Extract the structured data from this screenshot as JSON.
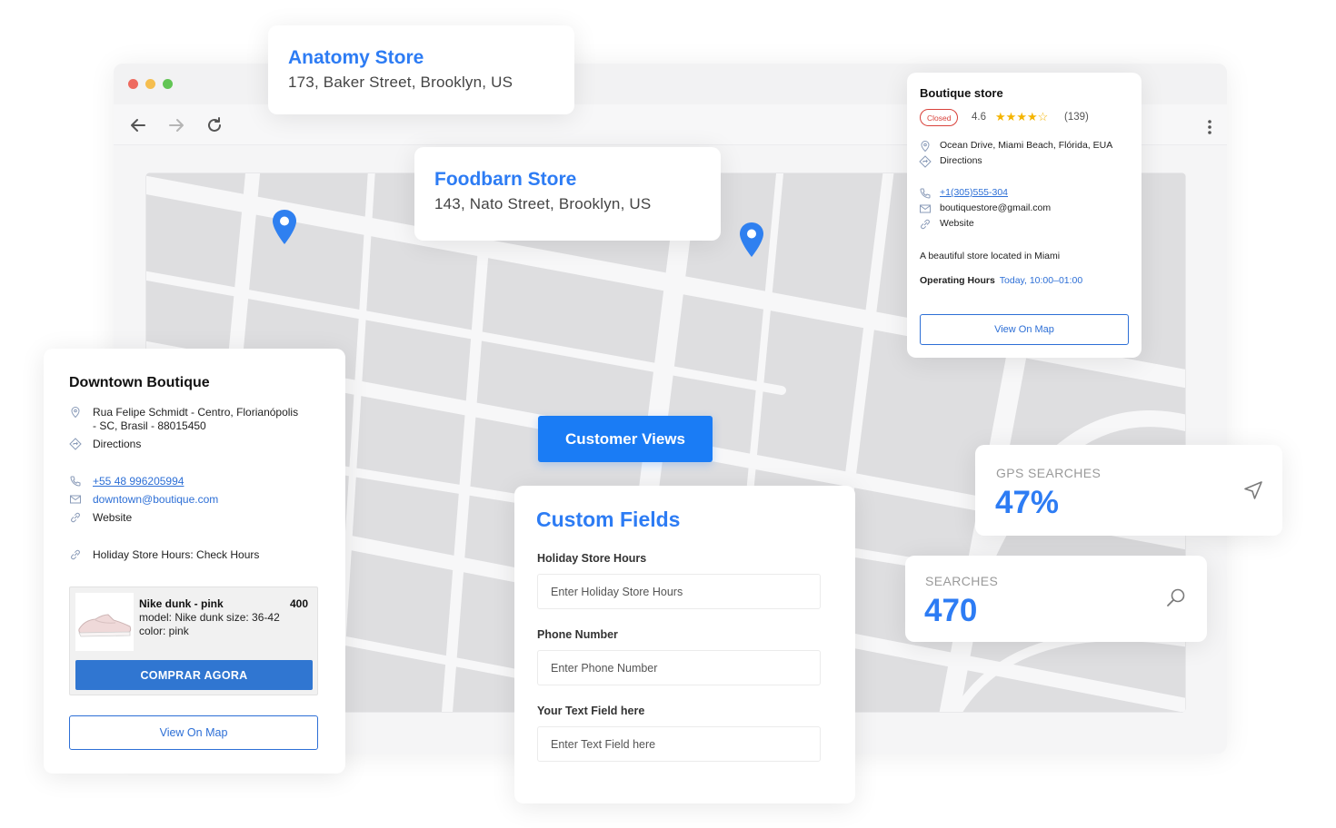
{
  "browser": {
    "nav": {
      "back": "arrow-left-icon",
      "forward": "arrow-right-icon",
      "reload": "reload-icon",
      "menu": "kebab-menu-icon"
    }
  },
  "anatomy_store": {
    "name": "Anatomy Store",
    "address": "173, Baker Street, Brooklyn, US"
  },
  "foodbarn_store": {
    "name": "Foodbarn Store",
    "address": "143, Nato Street, Brooklyn, US"
  },
  "boutique_store": {
    "name": "Boutique store",
    "status": "Closed",
    "rating": "4.6",
    "stars": 4,
    "reviews": "(139)",
    "address": "Ocean Drive, Miami Beach, Flórida, EUA",
    "directions": "Directions",
    "phone": "+1(305)555-304",
    "email": "boutiquestore@gmail.com",
    "website": "Website",
    "description": "A beautiful store located in Miami",
    "hours_label": "Operating Hours",
    "hours_value": "Today, 10:00–01:00",
    "view_on_map": "View On Map"
  },
  "downtown_boutique": {
    "name": "Downtown Boutique",
    "address_line1": "Rua Felipe Schmidt - Centro, Florianópolis",
    "address_line2": "- SC, Brasil - 88015450",
    "directions": "Directions",
    "phone": "+55 48 996205994",
    "email": "downtown@boutique.com",
    "website": "Website",
    "holiday_hours": "Holiday Store Hours: Check Hours",
    "product": {
      "name": "Nike dunk - pink",
      "price": "400",
      "model": "model: Nike dunk size: 36-42",
      "color": "color: pink",
      "buy_button": "COMPRAR AGORA"
    },
    "view_on_map": "View On Map"
  },
  "customer_views_button": "Customer Views",
  "custom_fields": {
    "title": "Custom Fields",
    "fields": [
      {
        "label": "Holiday Store Hours",
        "placeholder": "Enter Holiday Store Hours"
      },
      {
        "label": "Phone Number",
        "placeholder": "Enter Phone Number"
      },
      {
        "label": "Your Text Field here",
        "placeholder": "Enter Text Field here"
      }
    ]
  },
  "gps_searches": {
    "label": "GPS SEARCHES",
    "value": "47%",
    "icon": "navigation-arrow-icon"
  },
  "searches": {
    "label": "SEARCHES",
    "value": "470",
    "icon": "search-icon"
  },
  "colors": {
    "accent": "#2d7cf4",
    "button_blue": "#1a7cf5",
    "buy_button": "#3076d1",
    "closed_red": "#d9423b",
    "star": "#f4b400"
  }
}
